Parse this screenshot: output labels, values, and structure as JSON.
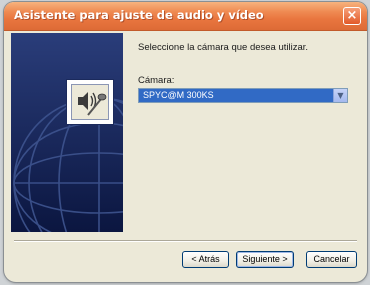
{
  "window": {
    "title": "Asistente para ajuste de audio y vídeo",
    "close_symbol": "×"
  },
  "side_panel": {
    "graphic": "globe-graphic",
    "icon": "speaker-microphone-icon"
  },
  "content": {
    "instruction": "Seleccione la cámara que desea utilizar.",
    "camera_label": "Cámara:",
    "camera_value": "SPYC@M 300KS",
    "dropdown_symbol": "▼"
  },
  "buttons": {
    "back": "< Atrás",
    "next": "Siguiente >",
    "cancel": "Cancelar"
  },
  "colors": {
    "titlebar": "#e9763f",
    "panel": "#0f1f52",
    "selection": "#316ac5"
  }
}
